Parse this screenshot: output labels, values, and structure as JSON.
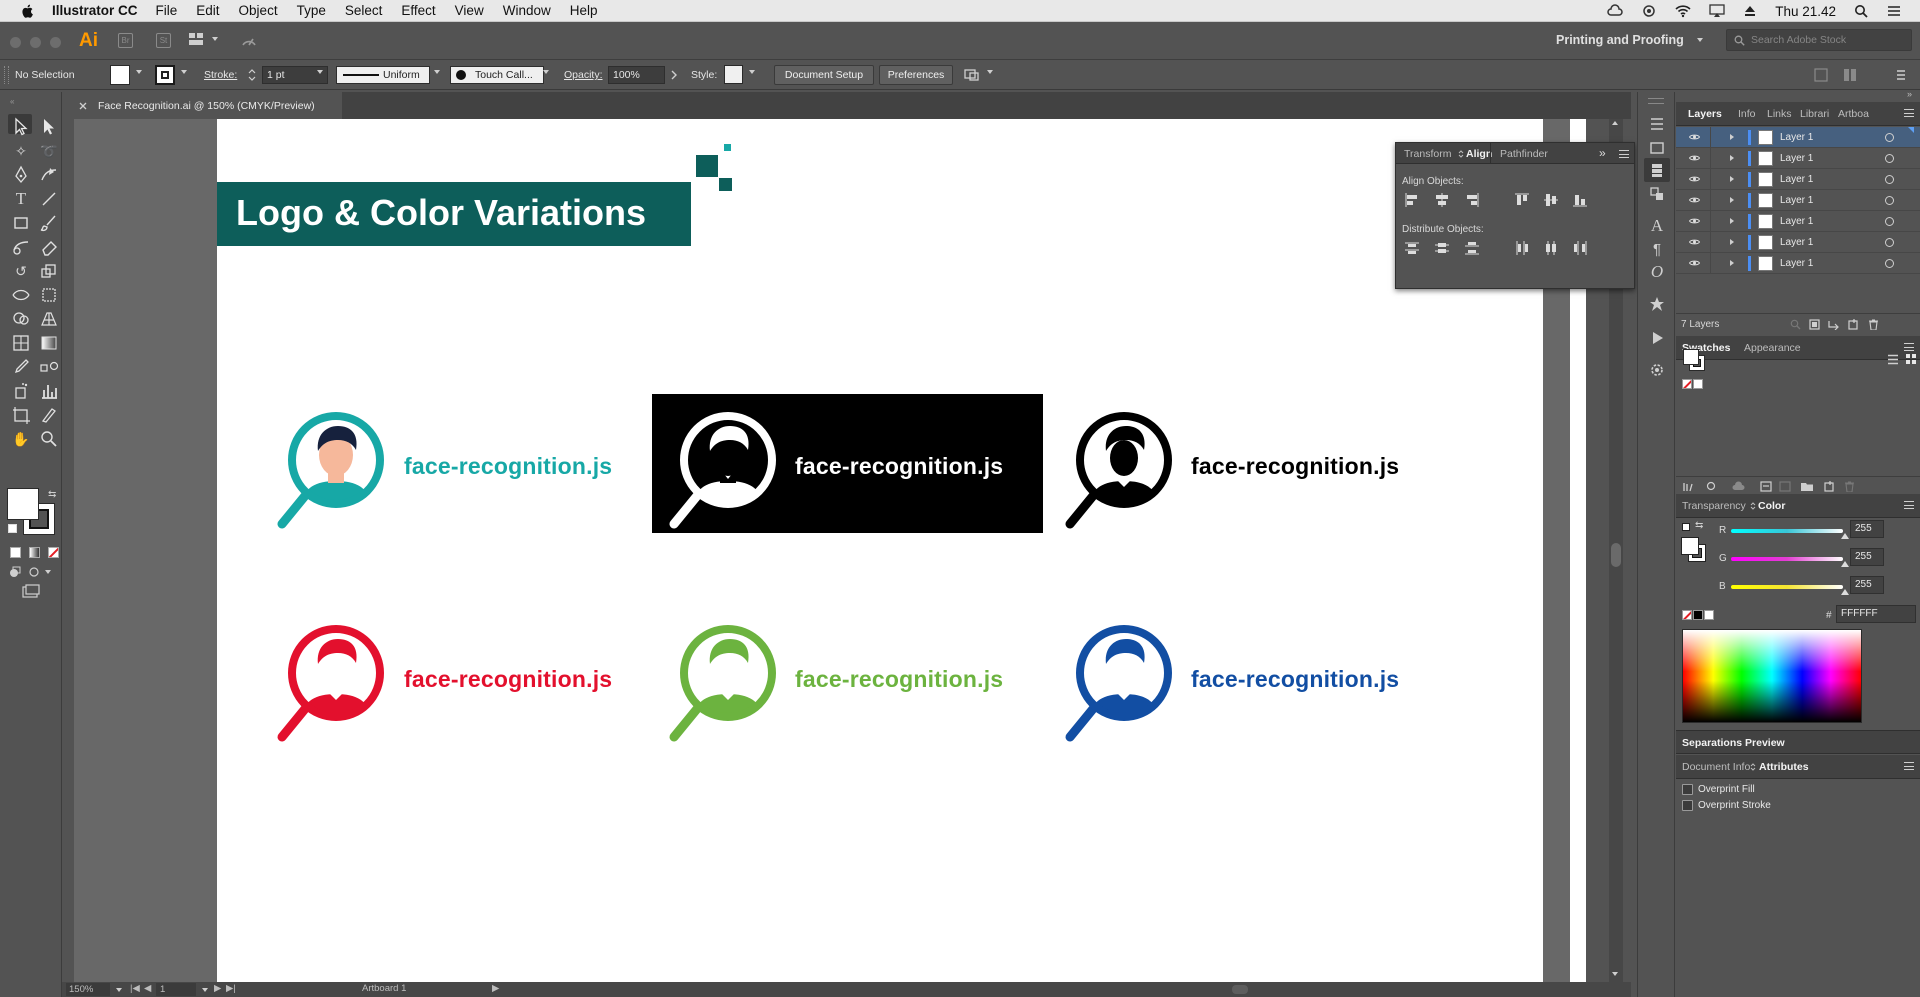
{
  "menubar": {
    "app": "Illustrator CC",
    "items": [
      "File",
      "Edit",
      "Object",
      "Type",
      "Select",
      "Effect",
      "View",
      "Window",
      "Help"
    ],
    "clock": "Thu 21.42"
  },
  "appbar": {
    "logo": "Ai",
    "bridge": "Br",
    "stock": "St",
    "workspace": "Printing and Proofing",
    "search_placeholder": "Search Adobe Stock"
  },
  "control": {
    "selection": "No Selection",
    "stroke_label": "Stroke:",
    "stroke_value": "1 pt",
    "profile": "Uniform",
    "brush": "Touch Call...",
    "opacity_label": "Opacity:",
    "opacity_value": "100%",
    "style_label": "Style:",
    "document_setup": "Document Setup",
    "preferences": "Preferences"
  },
  "document": {
    "tab_title": "Face Recognition.ai @ 150% (CMYK/Preview)"
  },
  "artboard": {
    "title": "Logo & Color Variations",
    "logo_text": "face-recognition.js",
    "colors": {
      "teal": "#17a8a6",
      "black": "#000000",
      "white": "#ffffff",
      "red": "#e3102d",
      "green": "#6cb33f",
      "blue": "#124ea3",
      "banner": "#0d5e5a"
    }
  },
  "align_panel": {
    "tabs": [
      "Transform",
      "Align",
      "Pathfinder"
    ],
    "active_tab": "Align",
    "align_objects": "Align Objects:",
    "distribute_objects": "Distribute Objects:"
  },
  "layers_panel": {
    "tabs": [
      "Layers",
      "Info",
      "Links",
      "Librari",
      "Artboa"
    ],
    "active_tab": "Layers",
    "layers": [
      "Layer 1",
      "Layer 1",
      "Layer 1",
      "Layer 1",
      "Layer 1",
      "Layer 1",
      "Layer 1"
    ],
    "count": "7 Layers"
  },
  "swatches_panel": {
    "tabs": [
      "Swatches",
      "Appearance"
    ],
    "active_tab": "Swatches"
  },
  "color_panel": {
    "tabs": [
      "Transparency",
      "Color"
    ],
    "active_tab": "Color",
    "channels": [
      {
        "label": "R",
        "value": "255",
        "color": "#39c6d8"
      },
      {
        "label": "G",
        "value": "255",
        "color": "#e23ed2"
      },
      {
        "label": "B",
        "value": "255",
        "color": "#f4e433"
      }
    ],
    "hex_label": "#",
    "hex_value": "FFFFFF"
  },
  "separations": {
    "title": "Separations Preview"
  },
  "attributes_panel": {
    "tabs": [
      "Document Info",
      "Attributes"
    ],
    "active_tab": "Attributes",
    "overprint_fill": "Overprint Fill",
    "overprint_stroke": "Overprint Stroke"
  },
  "statusbar": {
    "zoom": "150%",
    "artboard_num": "1",
    "artboard_name": "Artboard 1"
  }
}
